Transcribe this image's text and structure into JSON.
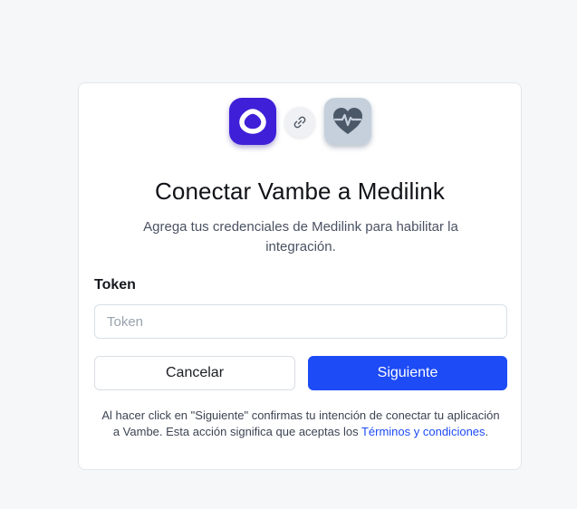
{
  "header": {
    "source_app_icon": "vambe-logo-icon",
    "link_icon": "link-icon",
    "target_app_icon": "heart-pulse-icon",
    "title": "Conectar Vambe a Medilink",
    "subtitle": "Agrega tus credenciales de Medilink para habilitar la integración."
  },
  "form": {
    "token_label": "Token",
    "token_placeholder": "Token",
    "token_value": ""
  },
  "actions": {
    "cancel_label": "Cancelar",
    "next_label": "Siguiente"
  },
  "disclaimer": {
    "text": "Al hacer click en \"Siguiente\" confirmas tu intención de conectar tu aplicación a Vambe. Esta acción significa que aceptas los ",
    "link_text": "Términos y condiciones",
    "suffix": "."
  },
  "colors": {
    "primary": "#1d4bf5",
    "vambe_brand": "#3f1fd8",
    "medilink_badge": "#c5d0dc",
    "page_background": "#f6f7f9"
  }
}
